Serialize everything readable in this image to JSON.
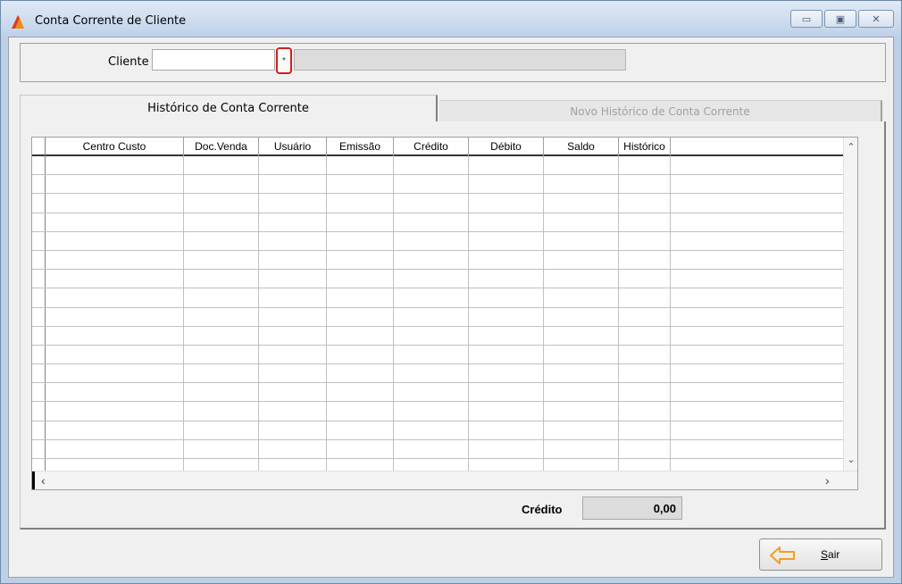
{
  "window": {
    "title": "Conta Corrente de Cliente",
    "controls": [
      "minimize-icon",
      "maximize-icon",
      "close-icon"
    ]
  },
  "search": {
    "label": "Cliente",
    "cliente_value": "",
    "lookup_label": "*",
    "nome_value": ""
  },
  "tabs": [
    {
      "label": "Histórico de Conta Corrente",
      "active": true
    },
    {
      "label": "Novo Histórico de Conta Corrente",
      "active": false
    }
  ],
  "grid": {
    "columns": [
      "Centro Custo",
      "Doc.Venda",
      "Usuário",
      "Emissão",
      "Crédito",
      "Débito",
      "Saldo",
      "Histórico"
    ],
    "rows": []
  },
  "footer": {
    "credito_label": "Crédito",
    "credito_value": "0,00"
  },
  "buttons": {
    "sair_first": "S",
    "sair_rest": "air"
  },
  "colors": {
    "accent_border": "#d0201c",
    "sair_arrow": "#f0a020"
  }
}
